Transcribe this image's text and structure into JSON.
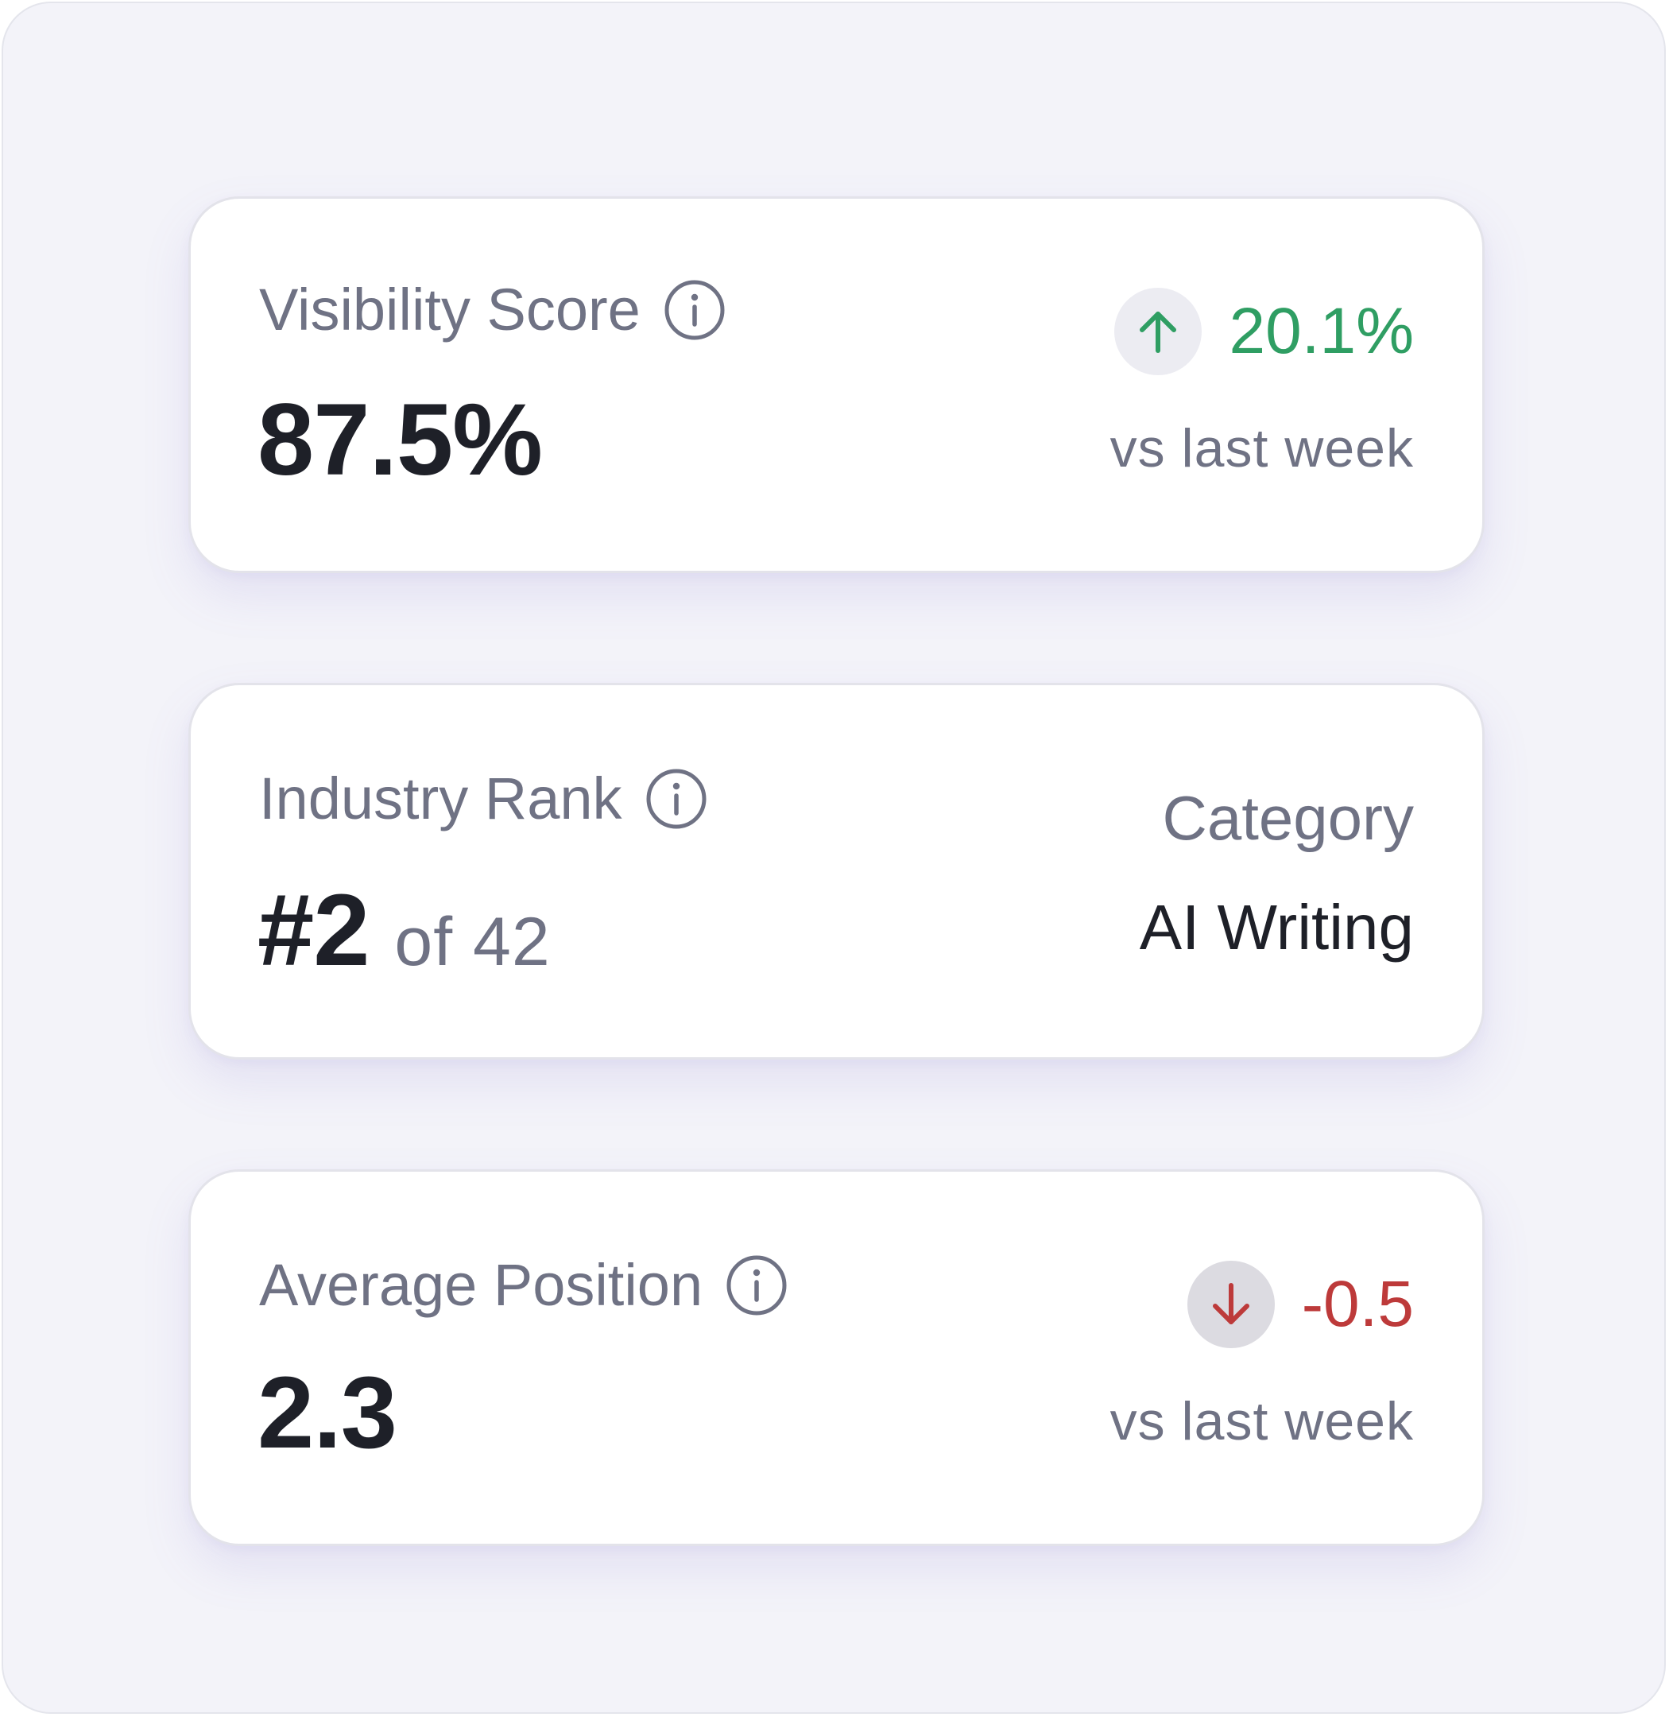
{
  "cards": [
    {
      "label": "Visibility Score",
      "info_icon": "info-circle-icon",
      "value": "87.5%",
      "change": {
        "direction": "up",
        "icon": "arrow-up-icon",
        "value": "20.1%",
        "compare": "vs last week",
        "color": "#2f9e63"
      }
    },
    {
      "label": "Industry Rank",
      "info_icon": "info-circle-icon",
      "value": "#2",
      "suffix": "of 42",
      "category_label": "Category",
      "category_value": "AI Writing"
    },
    {
      "label": "Average Position",
      "info_icon": "info-circle-icon",
      "value": "2.3",
      "change": {
        "direction": "down",
        "icon": "arrow-down-icon",
        "value": "-0.5",
        "compare": "vs last week",
        "color": "#bd3a3a"
      }
    }
  ],
  "colors": {
    "background": "#f3f3f9",
    "card": "#ffffff",
    "text_primary": "#1e2028",
    "text_secondary": "#6f7284",
    "positive": "#2f9e63",
    "negative": "#bd3a3a"
  }
}
